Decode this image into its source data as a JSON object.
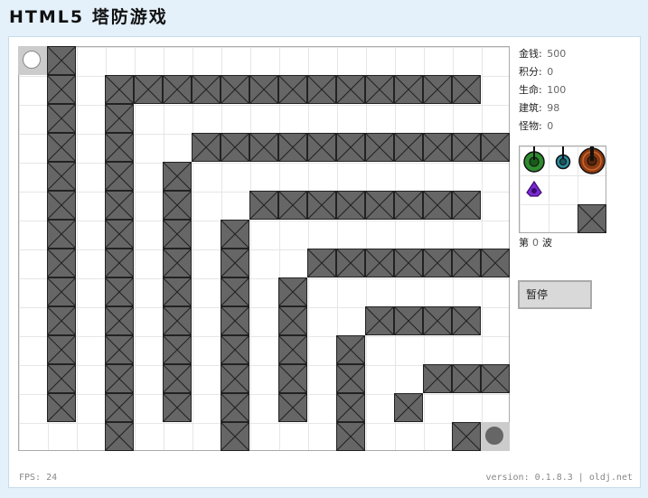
{
  "app": {
    "title": "HTML5 塔防游戏"
  },
  "stats": [
    {
      "label": "金钱:",
      "value": "500"
    },
    {
      "label": "积分:",
      "value": "0"
    },
    {
      "label": "生命:",
      "value": "100"
    },
    {
      "label": "建筑:",
      "value": "98"
    },
    {
      "label": "怪物:",
      "value": "0"
    }
  ],
  "wave": {
    "prefix": "第",
    "number": "0",
    "suffix": "波"
  },
  "controls": {
    "pause_label": "暂停"
  },
  "footer": {
    "fps": "FPS: 24",
    "version": "version: 0.1.8.3 | oldj.net"
  },
  "board": {
    "cols": 17,
    "rows": 14,
    "walls": [
      [
        1,
        0
      ],
      [
        1,
        1
      ],
      [
        1,
        2
      ],
      [
        1,
        3
      ],
      [
        1,
        4
      ],
      [
        1,
        5
      ],
      [
        1,
        6
      ],
      [
        1,
        7
      ],
      [
        1,
        8
      ],
      [
        1,
        9
      ],
      [
        1,
        10
      ],
      [
        1,
        11
      ],
      [
        1,
        12
      ],
      [
        3,
        1
      ],
      [
        4,
        1
      ],
      [
        5,
        1
      ],
      [
        6,
        1
      ],
      [
        7,
        1
      ],
      [
        8,
        1
      ],
      [
        9,
        1
      ],
      [
        10,
        1
      ],
      [
        11,
        1
      ],
      [
        12,
        1
      ],
      [
        13,
        1
      ],
      [
        14,
        1
      ],
      [
        15,
        1
      ],
      [
        3,
        2
      ],
      [
        3,
        3
      ],
      [
        3,
        4
      ],
      [
        3,
        5
      ],
      [
        3,
        6
      ],
      [
        3,
        7
      ],
      [
        3,
        8
      ],
      [
        3,
        9
      ],
      [
        3,
        10
      ],
      [
        3,
        11
      ],
      [
        3,
        12
      ],
      [
        3,
        13
      ],
      [
        6,
        3
      ],
      [
        7,
        3
      ],
      [
        8,
        3
      ],
      [
        9,
        3
      ],
      [
        10,
        3
      ],
      [
        11,
        3
      ],
      [
        12,
        3
      ],
      [
        13,
        3
      ],
      [
        14,
        3
      ],
      [
        15,
        3
      ],
      [
        16,
        3
      ],
      [
        5,
        4
      ],
      [
        5,
        5
      ],
      [
        5,
        6
      ],
      [
        5,
        7
      ],
      [
        5,
        8
      ],
      [
        5,
        9
      ],
      [
        5,
        10
      ],
      [
        5,
        11
      ],
      [
        5,
        12
      ],
      [
        8,
        5
      ],
      [
        9,
        5
      ],
      [
        10,
        5
      ],
      [
        11,
        5
      ],
      [
        12,
        5
      ],
      [
        13,
        5
      ],
      [
        14,
        5
      ],
      [
        15,
        5
      ],
      [
        7,
        6
      ],
      [
        7,
        7
      ],
      [
        7,
        8
      ],
      [
        7,
        9
      ],
      [
        7,
        10
      ],
      [
        7,
        11
      ],
      [
        7,
        12
      ],
      [
        7,
        13
      ],
      [
        10,
        7
      ],
      [
        11,
        7
      ],
      [
        12,
        7
      ],
      [
        13,
        7
      ],
      [
        14,
        7
      ],
      [
        15,
        7
      ],
      [
        16,
        7
      ],
      [
        9,
        8
      ],
      [
        9,
        9
      ],
      [
        9,
        10
      ],
      [
        9,
        11
      ],
      [
        9,
        12
      ],
      [
        12,
        9
      ],
      [
        13,
        9
      ],
      [
        14,
        9
      ],
      [
        15,
        9
      ],
      [
        11,
        10
      ],
      [
        11,
        11
      ],
      [
        11,
        12
      ],
      [
        11,
        13
      ],
      [
        14,
        11
      ],
      [
        15,
        11
      ],
      [
        16,
        11
      ],
      [
        13,
        12
      ],
      [
        15,
        13
      ]
    ],
    "entrance": [
      0,
      0
    ],
    "exit": [
      16,
      13
    ],
    "colors": {
      "wall": "#666666",
      "entrance_fill": "#ffffff",
      "exit_fill": "#666666"
    }
  },
  "shop": {
    "items": [
      {
        "name": "green-tower",
        "color": "#2e8b2e"
      },
      {
        "name": "blue-tower",
        "color": "#2a8a9a"
      },
      {
        "name": "brown-tower",
        "color": "#8b3a10"
      },
      {
        "name": "purple-tower",
        "color": "#7a2ad0"
      },
      {
        "name": "wall-block",
        "color": "#666666"
      }
    ]
  }
}
